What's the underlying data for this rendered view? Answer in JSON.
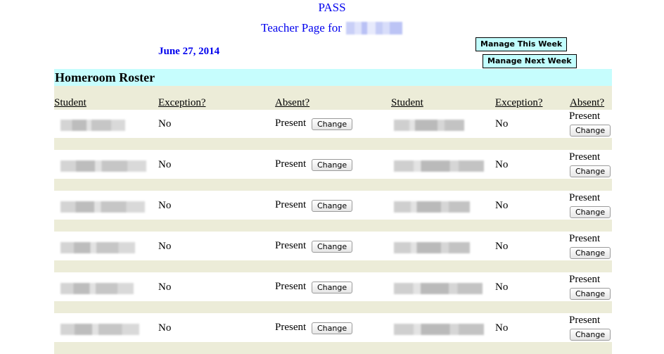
{
  "header": {
    "app_title": "PASS",
    "subtitle": "Teacher Page for",
    "date": "June 27, 2014"
  },
  "nav": {
    "manage_this_week": "Manage This Week",
    "manage_next_week": "Manage Next Week"
  },
  "roster": {
    "title": "Homeroom Roster",
    "columns": [
      "Student",
      "Exception?",
      "Absent?",
      "Student",
      "Exception?",
      "Absent?"
    ],
    "change_label": "Change",
    "rows": [
      {
        "left": {
          "exception": "No",
          "absent": "Present"
        },
        "right": {
          "exception": "No",
          "absent": "Present"
        }
      },
      {
        "left": {
          "exception": "No",
          "absent": "Present"
        },
        "right": {
          "exception": "No",
          "absent": "Present"
        }
      },
      {
        "left": {
          "exception": "No",
          "absent": "Present"
        },
        "right": {
          "exception": "No",
          "absent": "Present"
        }
      },
      {
        "left": {
          "exception": "No",
          "absent": "Present"
        },
        "right": {
          "exception": "No",
          "absent": "Present"
        }
      },
      {
        "left": {
          "exception": "No",
          "absent": "Present"
        },
        "right": {
          "exception": "No",
          "absent": "Present"
        }
      },
      {
        "left": {
          "exception": "No",
          "absent": "Present"
        },
        "right": {
          "exception": "No",
          "absent": "Present"
        }
      }
    ]
  },
  "colors": {
    "link_blue": "#0000ee",
    "header_cyan": "#c6fdfd",
    "band_beige": "#ececd8"
  }
}
